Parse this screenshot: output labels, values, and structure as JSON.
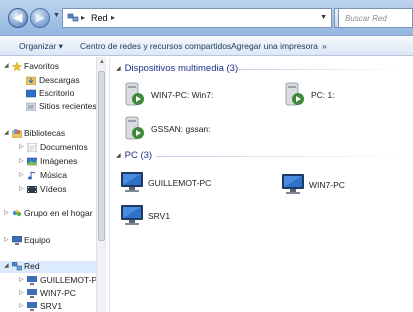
{
  "address": {
    "path": "Red",
    "search_placeholder": "Buscar Red"
  },
  "toolbar": {
    "organize": "Organizar ▾",
    "network_center": "Centro de redes y recursos compartidos",
    "add_printer": "Agregar una impresora",
    "more": "»"
  },
  "nav": {
    "favorites": "Favoritos",
    "downloads": "Descargas",
    "desktop": "Escritorio",
    "recent": "Sitios recientes",
    "libraries": "Bibliotecas",
    "documents": "Documentos",
    "images": "Imágenes",
    "music": "Música",
    "videos": "Vídeos",
    "homegroup": "Grupo en el hogar",
    "computer": "Equipo",
    "network": "Red",
    "net_items": [
      "GUILLEMOT-PC",
      "WIN7-PC",
      "SRV1"
    ]
  },
  "groups": {
    "multimedia": "Dispositivos multimedia (3)",
    "pc": "PC (3)"
  },
  "media_devices": [
    "WIN7-PC: Win7:",
    "PC: 1:",
    "GSSAN: gssan:"
  ],
  "computers": [
    "GUILLEMOT-PC",
    "WIN7-PC",
    "SRV1"
  ],
  "colors": {
    "group_header": "#1e3287",
    "toolbar_text": "#1e395b",
    "selected": "#dbeafc"
  }
}
